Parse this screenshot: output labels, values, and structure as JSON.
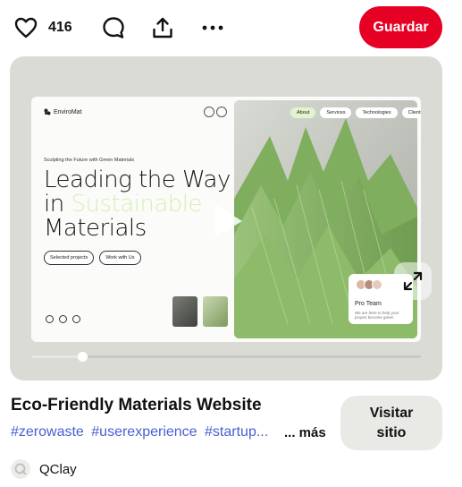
{
  "actions": {
    "like_count": "416",
    "save_label": "Guardar",
    "icons": [
      "heart-icon",
      "comment-icon",
      "share-icon",
      "more-icon"
    ]
  },
  "media": {
    "site": {
      "brand": "EnviroMat",
      "tagline": "Sculpting the Future with Green Materials",
      "headline_line1": "Leading the Way",
      "headline_in": "in",
      "headline_accent": "Sustainable",
      "headline_line3": "Materials",
      "btn_projects": "Selected projects",
      "btn_work": "Work with Us",
      "nav": [
        "About",
        "Services",
        "Technologies",
        "Clients"
      ],
      "team_title": "Pro Team",
      "team_text": "We are here to help your project become green"
    },
    "video_progress": 0.13
  },
  "pin": {
    "title": "Eco-Friendly Materials Website",
    "tags": [
      "#zerowaste",
      "#userexperience",
      "#startup..."
    ],
    "more_label": "... más",
    "visit_label": "Visitar sitio",
    "author": "QClay"
  },
  "colors": {
    "save": "#e60023",
    "tag": "#4a5fd1",
    "accent_green": "#d6efb6"
  }
}
